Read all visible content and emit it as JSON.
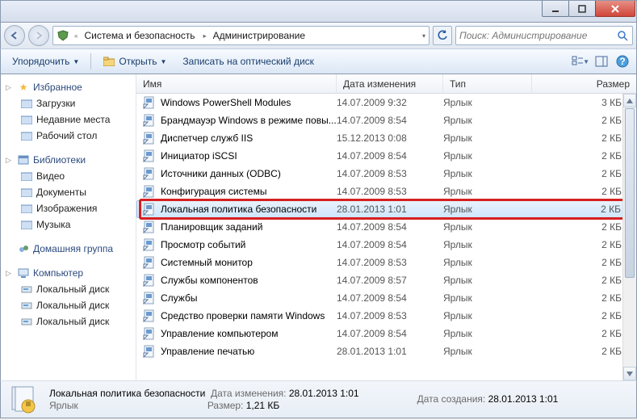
{
  "breadcrumb": {
    "seg1": "Система и безопасность",
    "seg2": "Администрирование"
  },
  "search": {
    "placeholder": "Поиск: Администрирование"
  },
  "toolbar": {
    "organize": "Упорядочить",
    "open": "Открыть",
    "burn": "Записать на оптический диск"
  },
  "columns": {
    "name": "Имя",
    "date": "Дата изменения",
    "type": "Тип",
    "size": "Размер"
  },
  "tree": {
    "favorites": {
      "title": "Избранное",
      "items": [
        "Загрузки",
        "Недавние места",
        "Рабочий стол"
      ]
    },
    "libraries": {
      "title": "Библиотеки",
      "items": [
        "Видео",
        "Документы",
        "Изображения",
        "Музыка"
      ]
    },
    "homegroup": {
      "title": "Домашняя группа"
    },
    "computer": {
      "title": "Компьютер",
      "items": [
        "Локальный диск",
        "Локальный диск",
        "Локальный диск"
      ]
    }
  },
  "files": [
    {
      "name": "Windows PowerShell Modules",
      "date": "14.07.2009 9:32",
      "type": "Ярлык",
      "size": "3 КБ"
    },
    {
      "name": "Брандмауэр Windows в режиме повы...",
      "date": "14.07.2009 8:54",
      "type": "Ярлык",
      "size": "2 КБ"
    },
    {
      "name": "Диспетчер служб IIS",
      "date": "15.12.2013 0:08",
      "type": "Ярлык",
      "size": "2 КБ"
    },
    {
      "name": "Инициатор iSCSI",
      "date": "14.07.2009 8:54",
      "type": "Ярлык",
      "size": "2 КБ"
    },
    {
      "name": "Источники данных (ODBC)",
      "date": "14.07.2009 8:53",
      "type": "Ярлык",
      "size": "2 КБ"
    },
    {
      "name": "Конфигурация системы",
      "date": "14.07.2009 8:53",
      "type": "Ярлык",
      "size": "2 КБ"
    },
    {
      "name": "Локальная политика безопасности",
      "date": "28.01.2013 1:01",
      "type": "Ярлык",
      "size": "2 КБ",
      "selected": true
    },
    {
      "name": "Планировщик заданий",
      "date": "14.07.2009 8:54",
      "type": "Ярлык",
      "size": "2 КБ"
    },
    {
      "name": "Просмотр событий",
      "date": "14.07.2009 8:54",
      "type": "Ярлык",
      "size": "2 КБ"
    },
    {
      "name": "Системный монитор",
      "date": "14.07.2009 8:53",
      "type": "Ярлык",
      "size": "2 КБ"
    },
    {
      "name": "Службы компонентов",
      "date": "14.07.2009 8:57",
      "type": "Ярлык",
      "size": "2 КБ"
    },
    {
      "name": "Службы",
      "date": "14.07.2009 8:54",
      "type": "Ярлык",
      "size": "2 КБ"
    },
    {
      "name": "Средство проверки памяти Windows",
      "date": "14.07.2009 8:53",
      "type": "Ярлык",
      "size": "2 КБ"
    },
    {
      "name": "Управление компьютером",
      "date": "14.07.2009 8:54",
      "type": "Ярлык",
      "size": "2 КБ"
    },
    {
      "name": "Управление печатью",
      "date": "28.01.2013 1:01",
      "type": "Ярлык",
      "size": "2 КБ"
    }
  ],
  "details": {
    "title": "Локальная политика безопасности",
    "type": "Ярлык",
    "k_mod": "Дата изменения:",
    "v_mod": "28.01.2013 1:01",
    "k_size": "Размер:",
    "v_size": "1,21 КБ",
    "k_created": "Дата создания:",
    "v_created": "28.01.2013 1:01"
  }
}
